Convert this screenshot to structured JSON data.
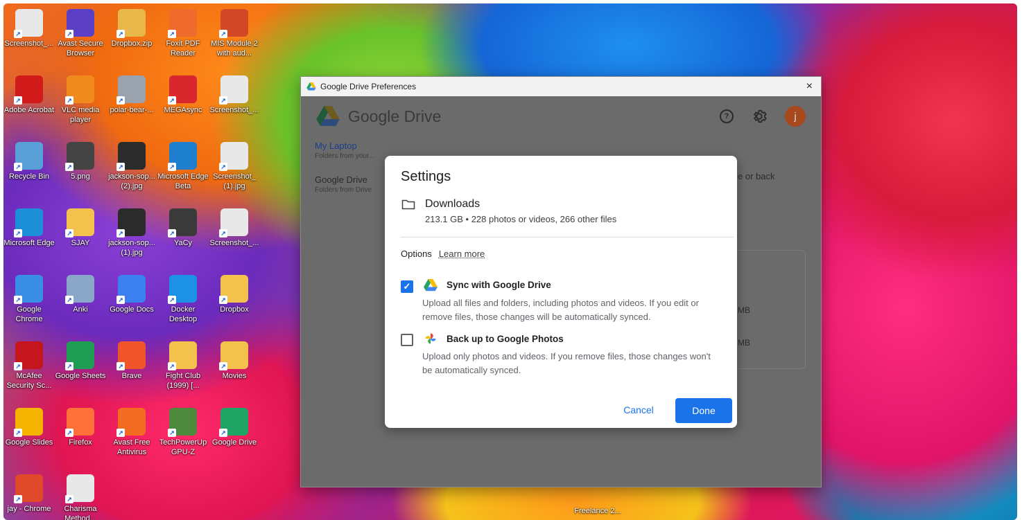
{
  "desktop_icons": [
    {
      "label": "Screenshot_...",
      "color": "#e8e8e8"
    },
    {
      "label": "Avast Secure Browser",
      "color": "#5b3fc4"
    },
    {
      "label": "Dropbox.zip",
      "color": "#e8b84a"
    },
    {
      "label": "Foxit PDF Reader",
      "color": "#ef6b2b"
    },
    {
      "label": "MIS Module 2 with aud...",
      "color": "#d24726"
    },
    {
      "label": "Adobe Acrobat",
      "color": "#d11b1b"
    },
    {
      "label": "VLC media player",
      "color": "#f08a1c"
    },
    {
      "label": "polar-bear-...",
      "color": "#9aa3ad"
    },
    {
      "label": "MEGAsync",
      "color": "#d9272e"
    },
    {
      "label": "Screenshot_...",
      "color": "#e8e8e8"
    },
    {
      "label": "Recycle Bin",
      "color": "#5aa0d8"
    },
    {
      "label": "5.png",
      "color": "#444"
    },
    {
      "label": "jackson-sop... (2).jpg",
      "color": "#2b2b2b"
    },
    {
      "label": "Microsoft Edge Beta",
      "color": "#1f7fcf"
    },
    {
      "label": "Screenshot_ (1).jpg",
      "color": "#e8e8e8"
    },
    {
      "label": "Microsoft Edge",
      "color": "#1c8fd8"
    },
    {
      "label": "SJAY",
      "color": "#f2c24d"
    },
    {
      "label": "jackson-sop... (1).jpg",
      "color": "#2b2b2b"
    },
    {
      "label": "YaCy",
      "color": "#3a3a3a"
    },
    {
      "label": "Screenshot_...",
      "color": "#e8e8e8"
    },
    {
      "label": "Google Chrome",
      "color": "#3a8ee6"
    },
    {
      "label": "Anki",
      "color": "#8aa6c9"
    },
    {
      "label": "Google Docs",
      "color": "#3b7ff0"
    },
    {
      "label": "Docker Desktop",
      "color": "#1d91e6"
    },
    {
      "label": "Dropbox",
      "color": "#f2c24d"
    },
    {
      "label": "McAfee Security Sc...",
      "color": "#c4161c"
    },
    {
      "label": "Google Sheets",
      "color": "#1f9d55"
    },
    {
      "label": "Brave",
      "color": "#f1562b"
    },
    {
      "label": "Fight Club (1999) [...",
      "color": "#f2c24d"
    },
    {
      "label": "Movies",
      "color": "#f2c24d"
    },
    {
      "label": "Google Slides",
      "color": "#f4b400"
    },
    {
      "label": "Firefox",
      "color": "#ff7139"
    },
    {
      "label": "Avast Free Antivirus",
      "color": "#f26d21"
    },
    {
      "label": "TechPowerUp GPU-Z",
      "color": "#4d8a3d"
    },
    {
      "label": "Google Drive",
      "color": "#1fa463"
    },
    {
      "label": "jay - Chrome",
      "color": "#e04a2a"
    },
    {
      "label": "Charisma Method...",
      "color": "#e8e8e8"
    }
  ],
  "desktop_extra_label": "Freelance 2...",
  "window": {
    "title": "Google Drive Preferences",
    "close_label": "×",
    "brand_google": "Google",
    "brand_drive": "Drive",
    "help_label": "?",
    "avatar_letter": "j"
  },
  "nav": [
    {
      "title": "My Laptop",
      "subtitle": "Folders from your..."
    },
    {
      "title": "Google Drive",
      "subtitle": "Folders from Drive"
    }
  ],
  "background_text": {
    "back": "e or back",
    "mb1": "MB",
    "mb2": "MB"
  },
  "dialog": {
    "title": "Settings",
    "folder_name": "Downloads",
    "folder_stats": "213.1 GB • 228 photos or videos, 266 other files",
    "options_label": "Options",
    "learn_more": "Learn more",
    "sync_title": "Sync with Google Drive",
    "sync_desc": "Upload all files and folders, including photos and videos. If you edit or remove files, those changes will be automatically synced.",
    "sync_checked": true,
    "backup_title": "Back up to Google Photos",
    "backup_desc": "Upload only photos and videos. If you remove files, those changes won't be automatically synced.",
    "backup_checked": false,
    "cancel_label": "Cancel",
    "done_label": "Done"
  },
  "colors": {
    "accent": "#1a73e8",
    "avatar": "#a8481d"
  }
}
